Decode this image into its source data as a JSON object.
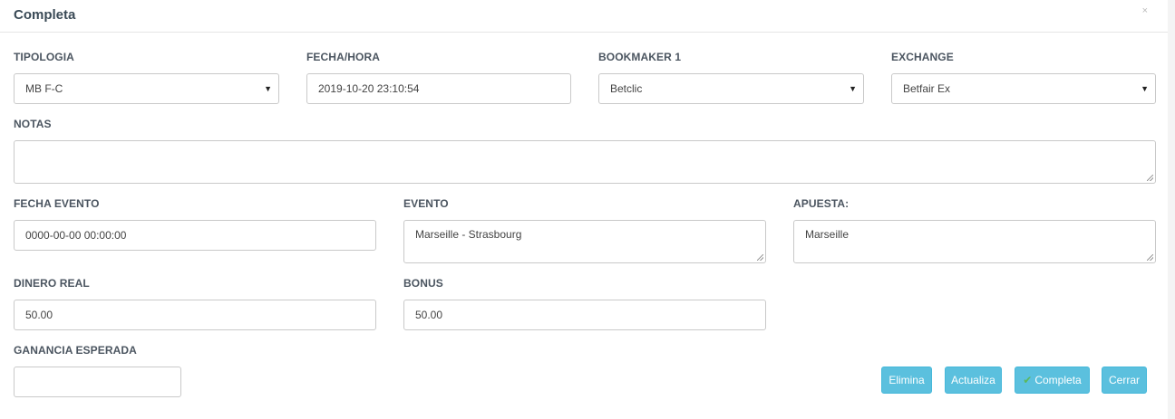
{
  "modal": {
    "title": "Completa",
    "close_label": "×"
  },
  "fields": {
    "tipologia": {
      "label": "TIPOLOGIA",
      "value": "MB F-C"
    },
    "fecha_hora": {
      "label": "FECHA/HORA",
      "value": "2019-10-20 23:10:54"
    },
    "bookmaker1": {
      "label": "BOOKMAKER 1",
      "value": "Betclic"
    },
    "exchange": {
      "label": "EXCHANGE",
      "value": "Betfair Ex"
    },
    "notas": {
      "label": "NOTAS",
      "value": ""
    },
    "fecha_evento": {
      "label": "FECHA EVENTO",
      "value": "0000-00-00 00:00:00"
    },
    "evento": {
      "label": "EVENTO",
      "value": "Marseille - Strasbourg"
    },
    "apuesta": {
      "label": "APUESTA:",
      "value": "Marseille"
    },
    "dinero_real": {
      "label": "DINERO REAL",
      "value": "50.00"
    },
    "bonus": {
      "label": "BONUS",
      "value": "50.00"
    },
    "ganancia_esperada": {
      "label": "GANANCIA ESPERADA",
      "value": ""
    }
  },
  "buttons": {
    "elimina": "Elimina",
    "actualiza": "Actualiza",
    "completa": "Completa",
    "cerrar": "Cerrar"
  },
  "colors": {
    "button_info": "#5bc0de",
    "check": "#5cb85c"
  }
}
